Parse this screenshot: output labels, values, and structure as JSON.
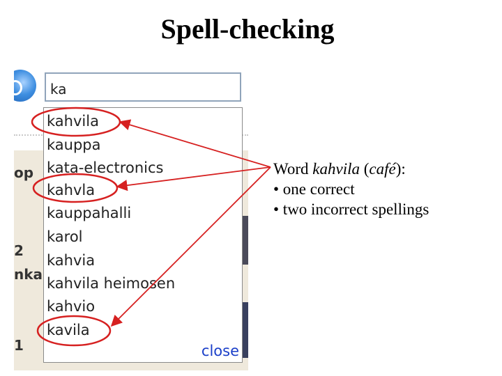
{
  "title": "Spell-checking",
  "search": {
    "value": "ka"
  },
  "suggestions": [
    "kahvila",
    "kauppa",
    "kata-electronics",
    "kahvla",
    "kauppahalli",
    "karol",
    "kahvia",
    "kahvila heimosen",
    "kahvio",
    "kavila"
  ],
  "close_label": "close",
  "background_fragments": {
    "a": "op",
    "b": "2",
    "c": "nka",
    "d": "1"
  },
  "annotation": {
    "line1_prefix": "Word ",
    "word": "kahvila",
    "line1_mid": " (",
    "gloss": "café",
    "line1_suffix": "):",
    "bullet1": "• one correct",
    "bullet2": "• two incorrect spellings"
  },
  "colors": {
    "highlight": "#d62020",
    "link": "#1a3fc9",
    "input_border": "#90a4ba"
  }
}
